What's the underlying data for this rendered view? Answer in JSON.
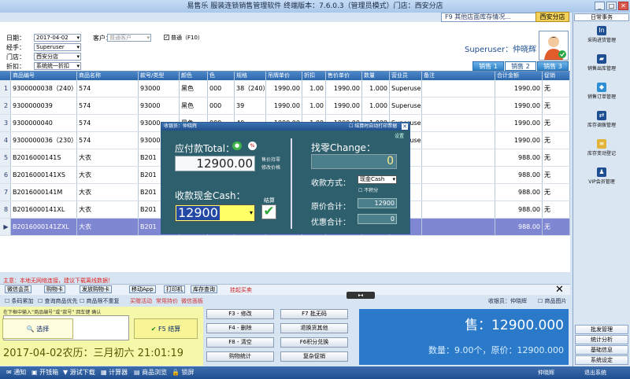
{
  "window": {
    "title": "易售乐 服装连锁销售管理软件 终端版本：7.6.0.3（管理员模式）门店：西安分店"
  },
  "top": {
    "f9_label": "F9 其他店面库存情况...",
    "branch_button": "西安分店"
  },
  "form": {
    "date_label": "日期：",
    "date_value": "2017-04-02",
    "operator_label": "经手：",
    "operator_value": "Superuser",
    "store_label": "门店：",
    "store_value": "西安分店",
    "discount_label": "折扣：",
    "discount_value": "系统统一折扣",
    "customer_label": "客户：",
    "customer_placeholder": "普通客户",
    "normal_label": "普通（F10）",
    "user_display": "Superuser：仲晓辉"
  },
  "tabs": [
    "销售 1",
    "销售 2",
    "销售 3"
  ],
  "grid": {
    "columns": [
      "商品编号",
      "商品名称",
      "款号/类型",
      "颜色",
      "色",
      "规格",
      "吊牌单价",
      "折扣",
      "售价单价",
      "数量",
      "营业员",
      "备注",
      "合计金额",
      "促销"
    ],
    "rows": [
      [
        "9300000038（240）",
        "574",
        "93000",
        "黑色",
        "000",
        "38（240）",
        "1990.00",
        "1.00",
        "1990.00",
        "1.000",
        "Superuser",
        "",
        "1990.00",
        "无"
      ],
      [
        "9300000039",
        "574",
        "93000",
        "黑色",
        "000",
        "39",
        "1990.00",
        "1.00",
        "1990.00",
        "1.000",
        "Superuser",
        "",
        "1990.00",
        "无"
      ],
      [
        "9300000040",
        "574",
        "93000",
        "黑色",
        "000",
        "40",
        "1990.00",
        "1.00",
        "1990.00",
        "1.000",
        "Superuser",
        "",
        "1990.00",
        "无"
      ],
      [
        "9300000036（230）",
        "574",
        "93000",
        "黑色",
        "000",
        "36（230）",
        "1990.00",
        "1.00",
        "1990.00",
        "1.000",
        "Superuser",
        "",
        "1990.00",
        "无"
      ],
      [
        "B2016000141S",
        "大衣",
        "B201",
        "",
        "",
        "",
        "",
        "",
        "",
        "",
        "",
        "",
        "988.00",
        "无"
      ],
      [
        "B2016000141XS",
        "大衣",
        "B201",
        "",
        "",
        "",
        "",
        "",
        "",
        "",
        "",
        "",
        "988.00",
        "无"
      ],
      [
        "B2016000141M",
        "大衣",
        "B201",
        "",
        "",
        "",
        "",
        "",
        "",
        "",
        "",
        "",
        "988.00",
        "无"
      ],
      [
        "B2016000141XL",
        "大衣",
        "B201",
        "",
        "",
        "",
        "",
        "",
        "",
        "",
        "",
        "",
        "988.00",
        "无"
      ],
      [
        "B2016000141ZXL",
        "大衣",
        "B201",
        "",
        "",
        "",
        "",
        "",
        "",
        "",
        "",
        "",
        "988.00",
        "无"
      ]
    ]
  },
  "warning": "主意：本地无网络连接，建议下载离线数据！",
  "shortcuts": [
    "微信会员",
    "购物卡",
    "发放购物卡",
    "移动App",
    "打印机",
    "库存查询",
    "挂起买卖"
  ],
  "checks": [
    "条码累加",
    "查询商品优先",
    "商品限不重复",
    "买赠活动",
    "常用持价",
    "微信面板"
  ],
  "cashier_right": "收银员：仲晓辉",
  "product_image_label": "商品图片",
  "input_hint": "在下框中输入“商品编号”或“款号” 回车键 确认",
  "select_button": "选择",
  "pay_button": "F5 结算",
  "datetime_text": "2017-04-02农历：三月初六 21:01:19",
  "actions": [
    "F3 - 修改",
    "F4 - 删除",
    "F8 - 清空",
    "购物统计",
    "F7 批无码",
    "退换货其他",
    "F6积分兑换",
    "复杂促销"
  ],
  "summary": {
    "sale_amount": "售：12900.000",
    "detail": "数量：9.00个，原价：12900.000"
  },
  "dialog": {
    "title": "收银员：仲晓辉",
    "print_label": "结算时自动打印票据",
    "settings_label": "设置",
    "total_label": "应付款Total：",
    "total_value": "12900.00",
    "note1": "售价持零",
    "note2": "修改价格",
    "cash_label": "收款现金Cash：",
    "cash_value": "12900",
    "settle_label": "结算",
    "change_label": "找零Change：",
    "change_value": "0",
    "method_label": "收款方式：",
    "method_value": "现金Cash",
    "no_points": "不积分",
    "original_label": "原价合计：",
    "original_value": "12900",
    "discount_label": "优惠合计：",
    "discount_value": "0"
  },
  "sidebar": {
    "head": "日常事务",
    "items": [
      "采购进货管理",
      "销售出库管理",
      "销售订单管理",
      "库存调拨管理",
      "库存变动登记",
      "VIP会员管理"
    ],
    "buttons": [
      "批发管理",
      "统计分析",
      "基础信息",
      "系统设定",
      "退出系统"
    ]
  },
  "footer": [
    "通知",
    "开钱箱",
    "源试下载",
    "计算器",
    "商品浏览",
    "锁屏"
  ],
  "footer_user": "仲晓辉",
  "colors": {
    "accent": "#2a7ac9",
    "dialog": "#2e5f6d",
    "selected_row": "#7f86d2"
  }
}
